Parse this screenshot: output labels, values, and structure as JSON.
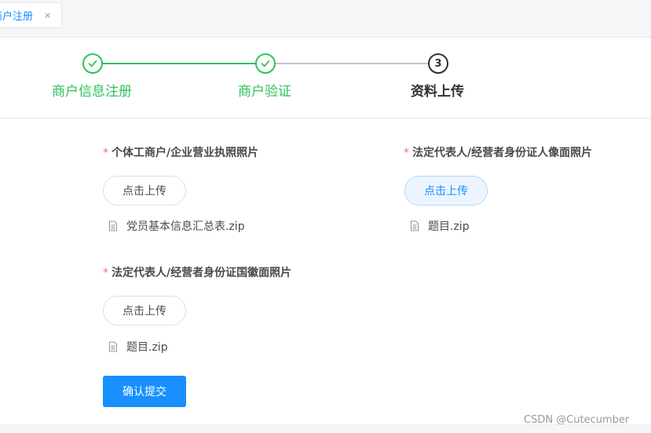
{
  "tab": {
    "label": "商户注册",
    "close_glyph": "×"
  },
  "steps": {
    "items": [
      {
        "title": "商户信息注册",
        "status": "finished",
        "icon": "check-icon"
      },
      {
        "title": "商户验证",
        "status": "finished",
        "icon": "check-icon"
      },
      {
        "title": "资料上传",
        "status": "process",
        "number": "3"
      }
    ]
  },
  "fields": [
    {
      "required": "*",
      "label": "个体工商户/企业营业执照照片",
      "button": "点击上传",
      "file": "党员基本信息汇总表.zip"
    },
    {
      "required": "*",
      "label": "法定代表人/经营者身份证人像面照片",
      "button": "点击上传",
      "file": "题目.zip"
    },
    {
      "required": "*",
      "label": "法定代表人/经营者身份证国徽面照片",
      "button": "点击上传",
      "file": "题目.zip"
    }
  ],
  "submit_label": "确认提交",
  "watermark": "CSDN @Cutecumber",
  "colors": {
    "success": "#2fc25b",
    "primary": "#1890ff",
    "required": "#f56c6c"
  }
}
